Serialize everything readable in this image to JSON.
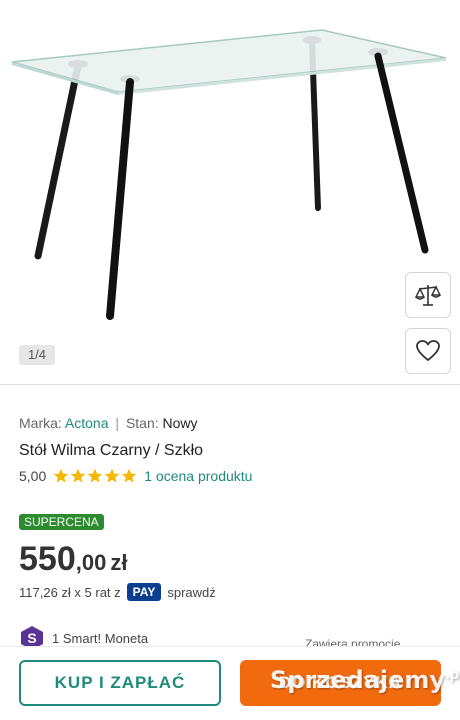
{
  "gallery": {
    "counter": "1/4",
    "compare_icon": "scales-icon",
    "favorite_icon": "heart-icon"
  },
  "product": {
    "brand_label": "Marka:",
    "brand_value": "Actona",
    "separator": "|",
    "condition_label": "Stan:",
    "condition_value": "Nowy",
    "title": "Stół Wilma Czarny / Szkło",
    "rating_score": "5,00",
    "rating_stars": 5,
    "rating_count_text": "1 ocena produktu"
  },
  "pricing": {
    "badge": "SUPERCENA",
    "price_integer": "550",
    "price_decimal": ",00",
    "currency": "zł",
    "installment_text": "117,26 zł x 5 rat z",
    "pay_logo": "PAY",
    "installment_link": "sprawdź"
  },
  "smart": {
    "logo_letter": "S",
    "text": "1 Smart! Moneta",
    "promo_text": "Zawiera promocje"
  },
  "actions": {
    "buy_label": "KUP I ZAPŁAĆ",
    "cart_label": "DO KOSZYKA"
  },
  "watermark": {
    "text": "Sprzedajemy",
    "tld": ".pl"
  },
  "colors": {
    "accent_teal": "#208b7a",
    "badge_green": "#2c8b2e",
    "cart_orange": "#f26a0e",
    "star_yellow": "#f5b700",
    "pay_blue": "#0a3f8f",
    "smart_purple": "#5a3494"
  }
}
